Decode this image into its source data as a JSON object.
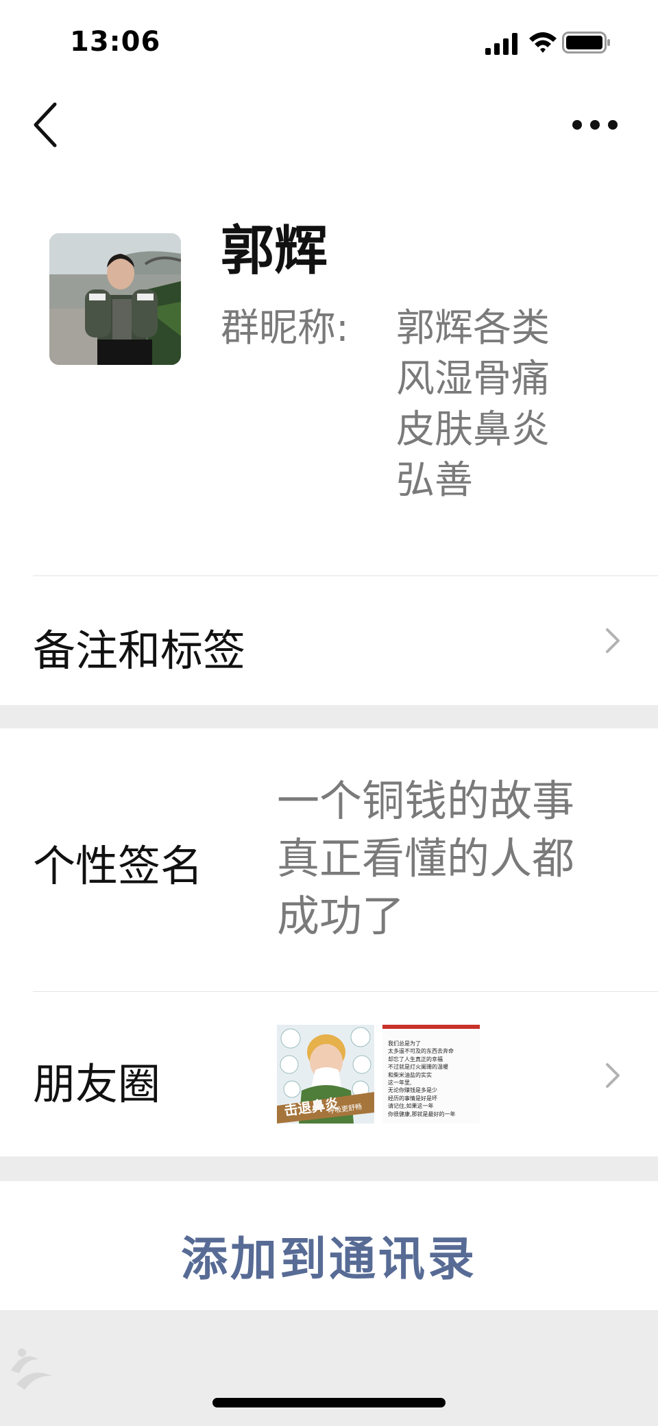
{
  "status_bar": {
    "time": "13:06",
    "icons": [
      "signal-icon",
      "wifi-icon",
      "battery-icon"
    ]
  },
  "nav": {
    "back_icon": "chevron-left-icon",
    "more_icon": "more-dots-icon"
  },
  "profile": {
    "name": "郭辉",
    "nickname_label": "群昵称:",
    "nickname_value": "郭辉各类风湿骨痛皮肤鼻炎弘善"
  },
  "rows": {
    "remark_label": "备注和标签",
    "signature_label": "个性签名",
    "signature_value": "一个铜钱的故事真正看懂的人都成功了",
    "moments_label": "朋友圈"
  },
  "moments_thumbs": [
    {
      "caption_main": "击退鼻炎",
      "caption_sub": "呼吸更舒畅"
    },
    {
      "lines": [
        "我们总是为了",
        "太多遥不可及的东西去奔命",
        "却忘了人生真正的幸福",
        "不过就是灯火阑珊的温暖",
        "和柴米油盐的实实",
        "这一年里,",
        "无论你赚钱是多是少",
        "经历的事情是好是坏",
        "请记住,如果这一年",
        "你很健康,那就是最好的一年"
      ]
    }
  ],
  "actions": {
    "add_contact": "添加到通讯录"
  },
  "colors": {
    "link_blue": "#576b95",
    "gray_text": "#7a7a7a",
    "background": "#ececec"
  }
}
